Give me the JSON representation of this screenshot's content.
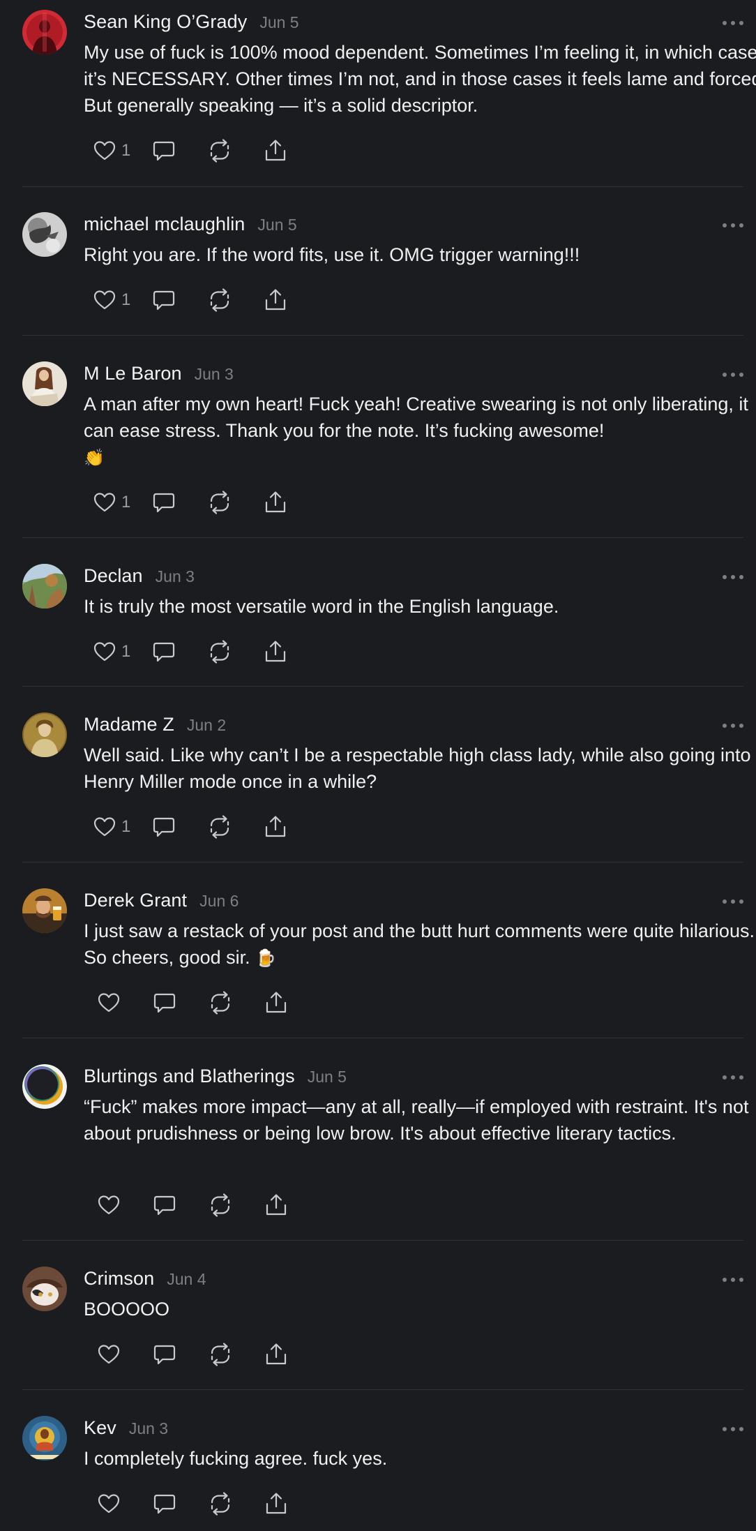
{
  "comments": [
    {
      "author": "Sean King O’Grady",
      "date": "Jun 5",
      "text": "My use of fuck is 100% mood dependent. Sometimes I’m feeling it, in which case it’s NECESSARY. Other times I’m not, and in those cases it feels lame and forced. But generally speaking — it’s a solid descriptor.",
      "likes": "1"
    },
    {
      "author": "michael mclaughlin",
      "date": "Jun 5",
      "text": "Right you are. If the word fits, use it. OMG trigger warning!!!",
      "likes": "1"
    },
    {
      "author": "M Le Baron",
      "date": "Jun 3",
      "text": "A man after my own heart! Fuck yeah! Creative swearing is not only liberating, it can ease stress. Thank you for the note. It’s fucking awesome!",
      "emoji": "👏",
      "likes": "1"
    },
    {
      "author": "Declan",
      "date": "Jun 3",
      "text": "It is truly the most versatile word in the English language.",
      "likes": "1"
    },
    {
      "author": "Madame Z",
      "date": "Jun 2",
      "text": "Well said. Like why can’t I be a respectable high class lady, while also going into Henry Miller mode once in a while?",
      "likes": "1"
    },
    {
      "author": "Derek Grant",
      "date": "Jun 6",
      "text": "I just saw a restack of your post and the butt hurt comments were quite hilarious. So cheers, good sir.",
      "emoji": "🍺",
      "likes": ""
    },
    {
      "author": "Blurtings and Blatherings",
      "date": "Jun 5",
      "text": "“Fuck” makes more impact—any at all, really—if employed with restraint. It's not about prudishness or being low brow. It's about effective literary tactics.",
      "likes": ""
    },
    {
      "author": "Crimson",
      "date": "Jun 4",
      "text": "BOOOOO",
      "likes": ""
    },
    {
      "author": "Kev",
      "date": "Jun 3",
      "text": "I completely fucking agree. fuck yes.",
      "likes": ""
    }
  ],
  "icons": {
    "like": "heart-icon",
    "reply": "speech-bubble-icon",
    "restack": "restack-arrows-icon",
    "share": "share-upload-icon",
    "more": "ellipsis-icon"
  },
  "colors": {
    "background": "#1b1c1f",
    "divider": "#303135",
    "text": "#f0f0f0",
    "muted": "#7d7f84"
  }
}
